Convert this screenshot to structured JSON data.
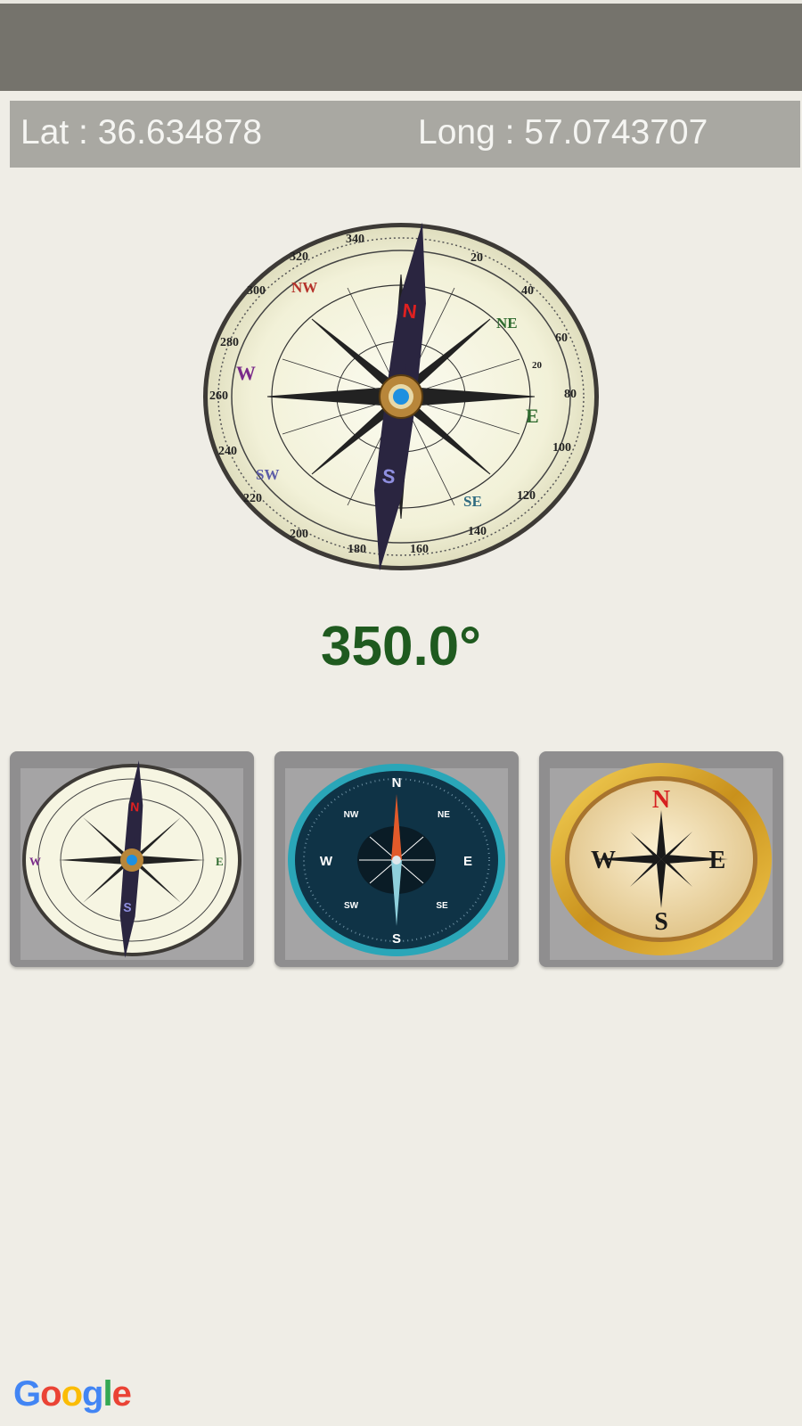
{
  "location": {
    "lat_text": "Lat : 36.634878",
    "long_text": "Long : 57.0743707"
  },
  "heading": {
    "value_text": "350.0°",
    "degrees": 350.0,
    "color": "#1f5a1f"
  },
  "main_compass": {
    "letters": {
      "n": "N",
      "s": "S",
      "e": "E",
      "w": "W",
      "ne": "NE",
      "nw": "NW",
      "se": "SE",
      "sw": "SW"
    },
    "ticks": [
      "340",
      "320",
      "300",
      "280",
      "260",
      "240",
      "220",
      "200",
      "180",
      "160",
      "140",
      "120",
      "100",
      "80",
      "60",
      "40",
      "20"
    ],
    "inner_tick": "20"
  },
  "compass_styles": [
    {
      "name": "Antique compass",
      "letters": [
        "N",
        "S",
        "E",
        "W"
      ]
    },
    {
      "name": "Teal compass",
      "letters": [
        "N",
        "S",
        "E",
        "W",
        "NW",
        "NE",
        "SW",
        "SE"
      ]
    },
    {
      "name": "Gold compass",
      "letters": [
        "N",
        "S",
        "E",
        "W"
      ]
    }
  ],
  "branding": {
    "google_letters": [
      "G",
      "o",
      "o",
      "g",
      "l",
      "e"
    ]
  },
  "colors": {
    "topbar": "#75736c",
    "coords_bar": "#a9a8a2",
    "background": "#efede6"
  }
}
